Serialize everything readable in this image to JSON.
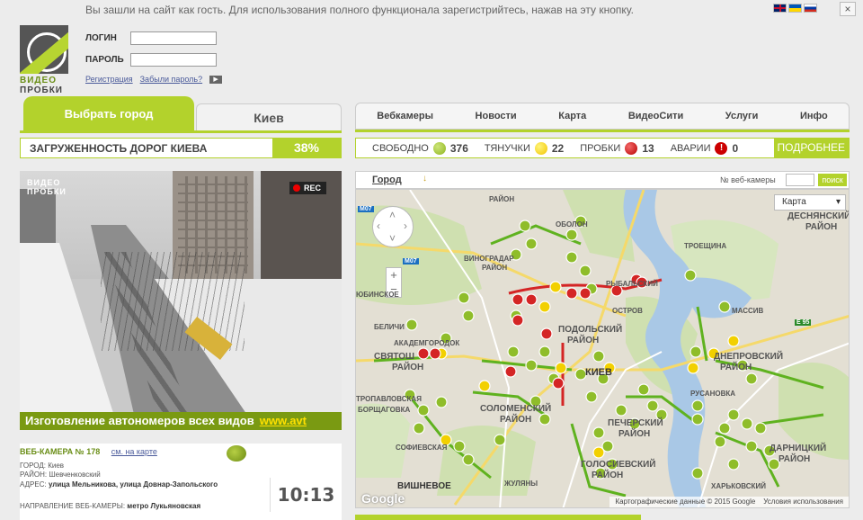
{
  "notice": "Вы зашли на сайт как гость. Для использования полного функционала зарегистрийтесь, нажав на эту кнопку.",
  "close_label": "×",
  "logo": {
    "line1": "ВИДЕО",
    "line2": "ПРОБКИ"
  },
  "login": {
    "login_label": "ЛОГИН",
    "password_label": "ПАРОЛЬ",
    "register_link": "Регистрация",
    "forgot_link": "Забыли пароль?"
  },
  "city_tabs": {
    "select_city": "Выбрать город",
    "current_city": "Киев"
  },
  "nav": [
    "Вебкамеры",
    "Новости",
    "Карта",
    "ВидеоСити",
    "Услуги",
    "Инфо"
  ],
  "load": {
    "label": "ЗАГРУЖЕННОСТЬ ДОРОГ КИЕВА",
    "value": "38%"
  },
  "status": {
    "free_label": "СВОБОДНО",
    "free_count": "376",
    "slow_label": "ТЯНУЧКИ",
    "slow_count": "22",
    "jams_label": "ПРОБКИ",
    "jams_count": "13",
    "accidents_label": "АВАРИИ",
    "accidents_count": "0",
    "more_label": "ПОДРОБНЕЕ"
  },
  "camera": {
    "logo_line1": "ВИДЕО",
    "logo_line2": "ПРОБКИ",
    "rec_label": "REC",
    "ad_text": "Изготовление автономеров всех видов",
    "ad_url": "www.avt",
    "id_label": "ВЕБ-КАМЕРА № 178",
    "map_link": "см. на карте",
    "city_label": "ГОРОД:",
    "city_value": "Киев",
    "district_label": "РАЙОН:",
    "district_value": "Шевченковский",
    "address_label": "АДРЕС:",
    "address_value": "улица Мельникова, улица Довнар-Запольского",
    "direction_label": "НАПРАВЛЕНИЕ ВЕБ-КАМЕРЫ:",
    "direction_value": "метро Лукьяновская",
    "time": "10:13"
  },
  "map": {
    "city_select": "Город",
    "cam_num_label": "№ веб-камеры",
    "search_label": "поиск",
    "map_type": "Карта",
    "footer_data": "Картографические данные © 2015 Google",
    "footer_terms": "Условия использования",
    "google_logo": "Google",
    "labels": {
      "district_top": "РАЙОН",
      "obolon": "ОБОЛОН",
      "vinogradar": "ВИНОГРАДАР",
      "vinogradar_district": "РАЙОН",
      "lyubinskoe": "ЮБИНСКОЕ",
      "troeshina": "ТРОЕЩИНА",
      "desnyansky": "ДЕСНЯНСКИЙ",
      "desnyansky_district": "РАЙОН",
      "rybalsky": "РЫБАЛЬСКИЙ",
      "ostrov": "ОСТРОВ",
      "podolsky": "ПОДОЛЬСКИЙ",
      "podolsky_district": "РАЙОН",
      "belichi": "БЕЛИЧИ",
      "akadem": "АКАДЕМГОРОДОК",
      "svyatosh": "СВЯТОШ",
      "svyatosh_district": "РАЙОН",
      "kiev": "КИЕВ",
      "dneprovsky": "ДНЕПРОВСКИЙ",
      "dneprovsky_district": "РАЙОН",
      "rusanovka": "РУСАНОВКА",
      "solomensky": "СОЛОМЕНСКИЙ",
      "solomensky_district": "РАЙОН",
      "pechersky": "ПЕЧЕРСКИЙ",
      "pechersky_district": "РАЙОН",
      "golosievsky": "ГОЛОСИЕВСКИЙ",
      "golosievsky_district": "РАЙОН",
      "darnitsky": "ДАРНИЦКИЙ",
      "darnitsky_district": "РАЙОН",
      "borschagovka": "БОРЩАГОВКА",
      "petropavl": "ТРОПАВЛОВСКАЯ",
      "sofievskaya": "СОФИЕВСКАЯ",
      "vishnevoe": "ВИШНЕВОЕ",
      "zhulyany": "ЖУЛЯНЫ",
      "kharkovsky": "ХАРЬКОВСКИЙ",
      "massiv": "МАССИВ",
      "m07_left": "M07",
      "m07_mid": "M07",
      "e95": "E 95"
    }
  }
}
